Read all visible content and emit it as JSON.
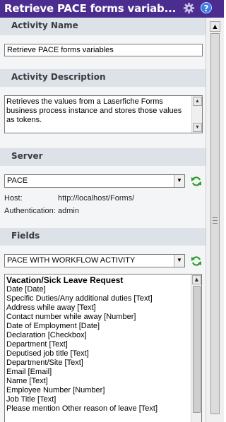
{
  "title": "Retrieve PACE forms variab...",
  "icons": {
    "settings": "gear-icon",
    "help": "help-icon",
    "refresh": "refresh-icon"
  },
  "colors": {
    "titlebar": "#4b2d8f",
    "section_header": "#dde2e8",
    "refresh_green": "#2e9e2e",
    "help_blue": "#3b7be8"
  },
  "activity_name": {
    "header": "Activity Name",
    "value": "Retrieve PACE forms variables"
  },
  "activity_description": {
    "header": "Activity Description",
    "value": "Retrieves the values from a Laserfiche Forms business process instance and stores those values as tokens."
  },
  "server": {
    "header": "Server",
    "selected": "PACE",
    "host_label": "Host:",
    "host_value": "http://localhost/Forms/",
    "auth_label": "Authentication:",
    "auth_value": "admin"
  },
  "fields": {
    "header": "Fields",
    "selected": "PACE WITH WORKFLOW ACTIVITY",
    "items": [
      "Vacation/Sick Leave Request",
      "Date [Date]",
      "Specific Duties/Any additional duties [Text]",
      "Address while away [Text]",
      "Contact number while away [Number]",
      "Date of Employment [Date]",
      "Declaration [Checkbox]",
      "Department [Text]",
      "Deputised job title [Text]",
      "Department/Site [Text]",
      "Email [Email]",
      "Name [Text]",
      "Employee Number [Number]",
      "Job Title [Text]",
      "Please mention Other reason of leave [Text]"
    ]
  }
}
